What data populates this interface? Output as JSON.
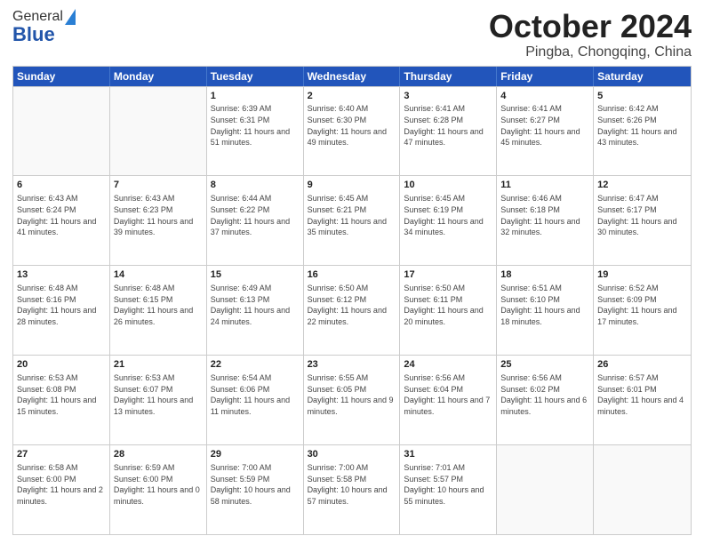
{
  "header": {
    "logo_general": "General",
    "logo_blue": "Blue",
    "title": "October 2024",
    "location": "Pingba, Chongqing, China"
  },
  "days_of_week": [
    "Sunday",
    "Monday",
    "Tuesday",
    "Wednesday",
    "Thursday",
    "Friday",
    "Saturday"
  ],
  "weeks": [
    [
      {
        "day": "",
        "info": ""
      },
      {
        "day": "",
        "info": ""
      },
      {
        "day": "1",
        "info": "Sunrise: 6:39 AM\nSunset: 6:31 PM\nDaylight: 11 hours and 51 minutes."
      },
      {
        "day": "2",
        "info": "Sunrise: 6:40 AM\nSunset: 6:30 PM\nDaylight: 11 hours and 49 minutes."
      },
      {
        "day": "3",
        "info": "Sunrise: 6:41 AM\nSunset: 6:28 PM\nDaylight: 11 hours and 47 minutes."
      },
      {
        "day": "4",
        "info": "Sunrise: 6:41 AM\nSunset: 6:27 PM\nDaylight: 11 hours and 45 minutes."
      },
      {
        "day": "5",
        "info": "Sunrise: 6:42 AM\nSunset: 6:26 PM\nDaylight: 11 hours and 43 minutes."
      }
    ],
    [
      {
        "day": "6",
        "info": "Sunrise: 6:43 AM\nSunset: 6:24 PM\nDaylight: 11 hours and 41 minutes."
      },
      {
        "day": "7",
        "info": "Sunrise: 6:43 AM\nSunset: 6:23 PM\nDaylight: 11 hours and 39 minutes."
      },
      {
        "day": "8",
        "info": "Sunrise: 6:44 AM\nSunset: 6:22 PM\nDaylight: 11 hours and 37 minutes."
      },
      {
        "day": "9",
        "info": "Sunrise: 6:45 AM\nSunset: 6:21 PM\nDaylight: 11 hours and 35 minutes."
      },
      {
        "day": "10",
        "info": "Sunrise: 6:45 AM\nSunset: 6:19 PM\nDaylight: 11 hours and 34 minutes."
      },
      {
        "day": "11",
        "info": "Sunrise: 6:46 AM\nSunset: 6:18 PM\nDaylight: 11 hours and 32 minutes."
      },
      {
        "day": "12",
        "info": "Sunrise: 6:47 AM\nSunset: 6:17 PM\nDaylight: 11 hours and 30 minutes."
      }
    ],
    [
      {
        "day": "13",
        "info": "Sunrise: 6:48 AM\nSunset: 6:16 PM\nDaylight: 11 hours and 28 minutes."
      },
      {
        "day": "14",
        "info": "Sunrise: 6:48 AM\nSunset: 6:15 PM\nDaylight: 11 hours and 26 minutes."
      },
      {
        "day": "15",
        "info": "Sunrise: 6:49 AM\nSunset: 6:13 PM\nDaylight: 11 hours and 24 minutes."
      },
      {
        "day": "16",
        "info": "Sunrise: 6:50 AM\nSunset: 6:12 PM\nDaylight: 11 hours and 22 minutes."
      },
      {
        "day": "17",
        "info": "Sunrise: 6:50 AM\nSunset: 6:11 PM\nDaylight: 11 hours and 20 minutes."
      },
      {
        "day": "18",
        "info": "Sunrise: 6:51 AM\nSunset: 6:10 PM\nDaylight: 11 hours and 18 minutes."
      },
      {
        "day": "19",
        "info": "Sunrise: 6:52 AM\nSunset: 6:09 PM\nDaylight: 11 hours and 17 minutes."
      }
    ],
    [
      {
        "day": "20",
        "info": "Sunrise: 6:53 AM\nSunset: 6:08 PM\nDaylight: 11 hours and 15 minutes."
      },
      {
        "day": "21",
        "info": "Sunrise: 6:53 AM\nSunset: 6:07 PM\nDaylight: 11 hours and 13 minutes."
      },
      {
        "day": "22",
        "info": "Sunrise: 6:54 AM\nSunset: 6:06 PM\nDaylight: 11 hours and 11 minutes."
      },
      {
        "day": "23",
        "info": "Sunrise: 6:55 AM\nSunset: 6:05 PM\nDaylight: 11 hours and 9 minutes."
      },
      {
        "day": "24",
        "info": "Sunrise: 6:56 AM\nSunset: 6:04 PM\nDaylight: 11 hours and 7 minutes."
      },
      {
        "day": "25",
        "info": "Sunrise: 6:56 AM\nSunset: 6:02 PM\nDaylight: 11 hours and 6 minutes."
      },
      {
        "day": "26",
        "info": "Sunrise: 6:57 AM\nSunset: 6:01 PM\nDaylight: 11 hours and 4 minutes."
      }
    ],
    [
      {
        "day": "27",
        "info": "Sunrise: 6:58 AM\nSunset: 6:00 PM\nDaylight: 11 hours and 2 minutes."
      },
      {
        "day": "28",
        "info": "Sunrise: 6:59 AM\nSunset: 6:00 PM\nDaylight: 11 hours and 0 minutes."
      },
      {
        "day": "29",
        "info": "Sunrise: 7:00 AM\nSunset: 5:59 PM\nDaylight: 10 hours and 58 minutes."
      },
      {
        "day": "30",
        "info": "Sunrise: 7:00 AM\nSunset: 5:58 PM\nDaylight: 10 hours and 57 minutes."
      },
      {
        "day": "31",
        "info": "Sunrise: 7:01 AM\nSunset: 5:57 PM\nDaylight: 10 hours and 55 minutes."
      },
      {
        "day": "",
        "info": ""
      },
      {
        "day": "",
        "info": ""
      }
    ]
  ]
}
